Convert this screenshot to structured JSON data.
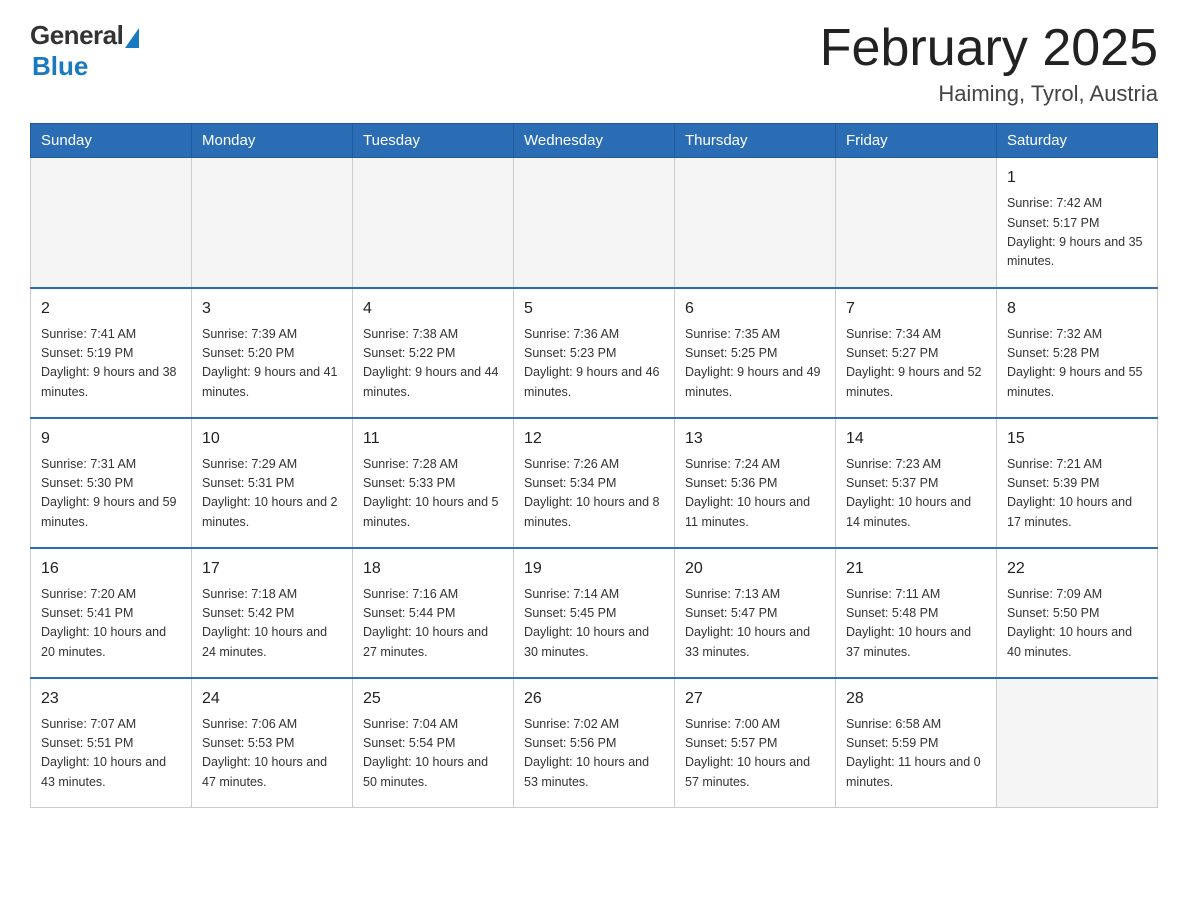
{
  "logo": {
    "general_text": "General",
    "blue_text": "Blue"
  },
  "title": "February 2025",
  "subtitle": "Haiming, Tyrol, Austria",
  "days_of_week": [
    "Sunday",
    "Monday",
    "Tuesday",
    "Wednesday",
    "Thursday",
    "Friday",
    "Saturday"
  ],
  "weeks": [
    [
      {
        "day": "",
        "info": ""
      },
      {
        "day": "",
        "info": ""
      },
      {
        "day": "",
        "info": ""
      },
      {
        "day": "",
        "info": ""
      },
      {
        "day": "",
        "info": ""
      },
      {
        "day": "",
        "info": ""
      },
      {
        "day": "1",
        "info": "Sunrise: 7:42 AM\nSunset: 5:17 PM\nDaylight: 9 hours and 35 minutes."
      }
    ],
    [
      {
        "day": "2",
        "info": "Sunrise: 7:41 AM\nSunset: 5:19 PM\nDaylight: 9 hours and 38 minutes."
      },
      {
        "day": "3",
        "info": "Sunrise: 7:39 AM\nSunset: 5:20 PM\nDaylight: 9 hours and 41 minutes."
      },
      {
        "day": "4",
        "info": "Sunrise: 7:38 AM\nSunset: 5:22 PM\nDaylight: 9 hours and 44 minutes."
      },
      {
        "day": "5",
        "info": "Sunrise: 7:36 AM\nSunset: 5:23 PM\nDaylight: 9 hours and 46 minutes."
      },
      {
        "day": "6",
        "info": "Sunrise: 7:35 AM\nSunset: 5:25 PM\nDaylight: 9 hours and 49 minutes."
      },
      {
        "day": "7",
        "info": "Sunrise: 7:34 AM\nSunset: 5:27 PM\nDaylight: 9 hours and 52 minutes."
      },
      {
        "day": "8",
        "info": "Sunrise: 7:32 AM\nSunset: 5:28 PM\nDaylight: 9 hours and 55 minutes."
      }
    ],
    [
      {
        "day": "9",
        "info": "Sunrise: 7:31 AM\nSunset: 5:30 PM\nDaylight: 9 hours and 59 minutes."
      },
      {
        "day": "10",
        "info": "Sunrise: 7:29 AM\nSunset: 5:31 PM\nDaylight: 10 hours and 2 minutes."
      },
      {
        "day": "11",
        "info": "Sunrise: 7:28 AM\nSunset: 5:33 PM\nDaylight: 10 hours and 5 minutes."
      },
      {
        "day": "12",
        "info": "Sunrise: 7:26 AM\nSunset: 5:34 PM\nDaylight: 10 hours and 8 minutes."
      },
      {
        "day": "13",
        "info": "Sunrise: 7:24 AM\nSunset: 5:36 PM\nDaylight: 10 hours and 11 minutes."
      },
      {
        "day": "14",
        "info": "Sunrise: 7:23 AM\nSunset: 5:37 PM\nDaylight: 10 hours and 14 minutes."
      },
      {
        "day": "15",
        "info": "Sunrise: 7:21 AM\nSunset: 5:39 PM\nDaylight: 10 hours and 17 minutes."
      }
    ],
    [
      {
        "day": "16",
        "info": "Sunrise: 7:20 AM\nSunset: 5:41 PM\nDaylight: 10 hours and 20 minutes."
      },
      {
        "day": "17",
        "info": "Sunrise: 7:18 AM\nSunset: 5:42 PM\nDaylight: 10 hours and 24 minutes."
      },
      {
        "day": "18",
        "info": "Sunrise: 7:16 AM\nSunset: 5:44 PM\nDaylight: 10 hours and 27 minutes."
      },
      {
        "day": "19",
        "info": "Sunrise: 7:14 AM\nSunset: 5:45 PM\nDaylight: 10 hours and 30 minutes."
      },
      {
        "day": "20",
        "info": "Sunrise: 7:13 AM\nSunset: 5:47 PM\nDaylight: 10 hours and 33 minutes."
      },
      {
        "day": "21",
        "info": "Sunrise: 7:11 AM\nSunset: 5:48 PM\nDaylight: 10 hours and 37 minutes."
      },
      {
        "day": "22",
        "info": "Sunrise: 7:09 AM\nSunset: 5:50 PM\nDaylight: 10 hours and 40 minutes."
      }
    ],
    [
      {
        "day": "23",
        "info": "Sunrise: 7:07 AM\nSunset: 5:51 PM\nDaylight: 10 hours and 43 minutes."
      },
      {
        "day": "24",
        "info": "Sunrise: 7:06 AM\nSunset: 5:53 PM\nDaylight: 10 hours and 47 minutes."
      },
      {
        "day": "25",
        "info": "Sunrise: 7:04 AM\nSunset: 5:54 PM\nDaylight: 10 hours and 50 minutes."
      },
      {
        "day": "26",
        "info": "Sunrise: 7:02 AM\nSunset: 5:56 PM\nDaylight: 10 hours and 53 minutes."
      },
      {
        "day": "27",
        "info": "Sunrise: 7:00 AM\nSunset: 5:57 PM\nDaylight: 10 hours and 57 minutes."
      },
      {
        "day": "28",
        "info": "Sunrise: 6:58 AM\nSunset: 5:59 PM\nDaylight: 11 hours and 0 minutes."
      },
      {
        "day": "",
        "info": ""
      }
    ]
  ]
}
